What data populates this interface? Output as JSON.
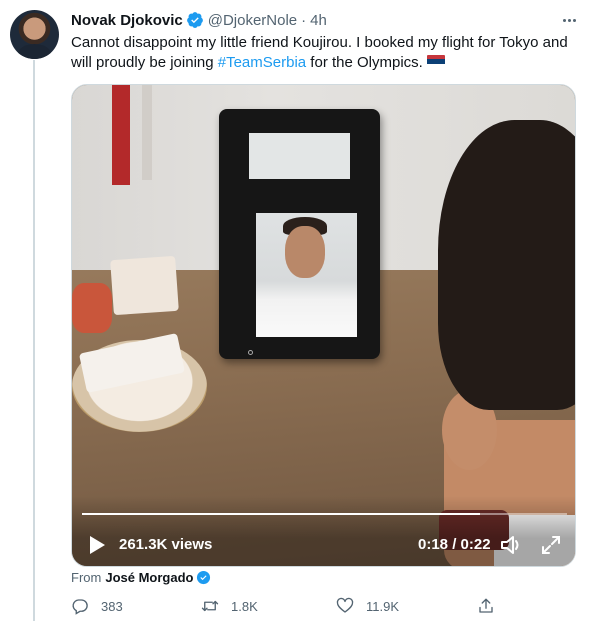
{
  "tweet": {
    "author_name": "Novak Djokovic",
    "author_handle": "@DjokerNole",
    "separator": "·",
    "time": "4h",
    "text_part1": "Cannot disappoint my little friend Koujirou. I booked my flight for Tokyo and will proudly be joining ",
    "hashtag": "#TeamSerbia",
    "text_part2": " for the Olympics.",
    "flag_emoji": "serbia-flag"
  },
  "video": {
    "views": "261.3K views",
    "current_time": "0:18",
    "time_separator": "/",
    "duration": "0:22",
    "progress": 0.82
  },
  "attribution": {
    "prefix": "From",
    "source_name": "José Morgado"
  },
  "actions": {
    "replies": "383",
    "retweets": "1.8K",
    "likes": "11.9K"
  },
  "colors": {
    "accent": "#1d9bf0",
    "secondary_text": "#536471",
    "flag_red": "#c6363c",
    "flag_blue": "#0c4076",
    "flag_white": "#ffffff"
  },
  "icons": [
    "verified-badge-icon",
    "more-icon",
    "play-icon",
    "volume-icon",
    "fullscreen-icon",
    "reply-icon",
    "retweet-icon",
    "like-icon",
    "share-icon"
  ]
}
